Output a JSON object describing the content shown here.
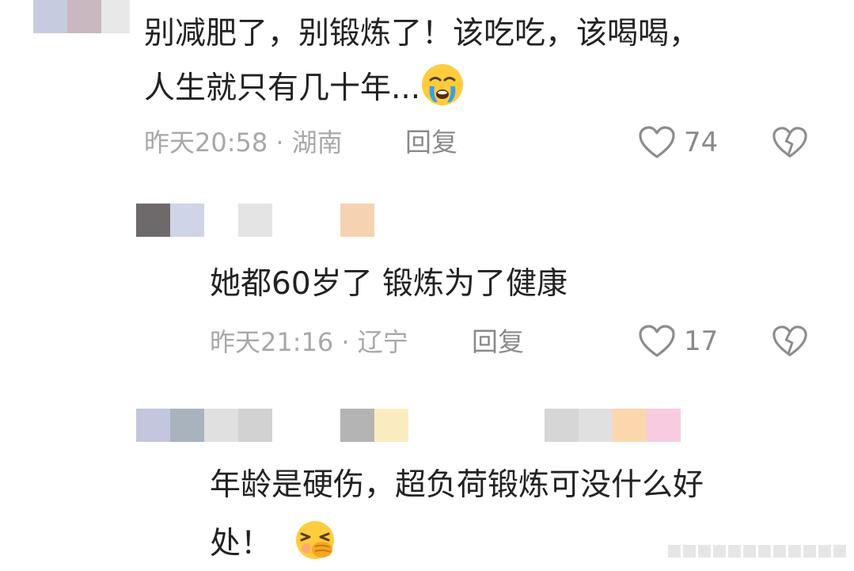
{
  "comments": [
    {
      "text_line1": "别减肥了，别锻炼了！该吃吃，该喝喝，",
      "text_line2": "人生就只有几十年...",
      "emoji": "loudly-crying-face",
      "time": "昨天20:58",
      "location": "湖南",
      "reply_label": "回复",
      "likes": "74"
    },
    {
      "text_line1": "她都60岁了 锻炼为了健康",
      "time": "昨天21:16",
      "location": "辽宁",
      "reply_label": "回复",
      "likes": "17"
    },
    {
      "text_line1": "年龄是硬伤，超负荷锻炼可没什么好",
      "text_line2": "处！",
      "emoji": "face-with-hand-over-mouth"
    }
  ],
  "separator": " · ",
  "colors": {
    "meta_text": "#a8a8a8",
    "reply_text": "#8a8a8a",
    "icon_stroke": "#8c8c8c"
  }
}
